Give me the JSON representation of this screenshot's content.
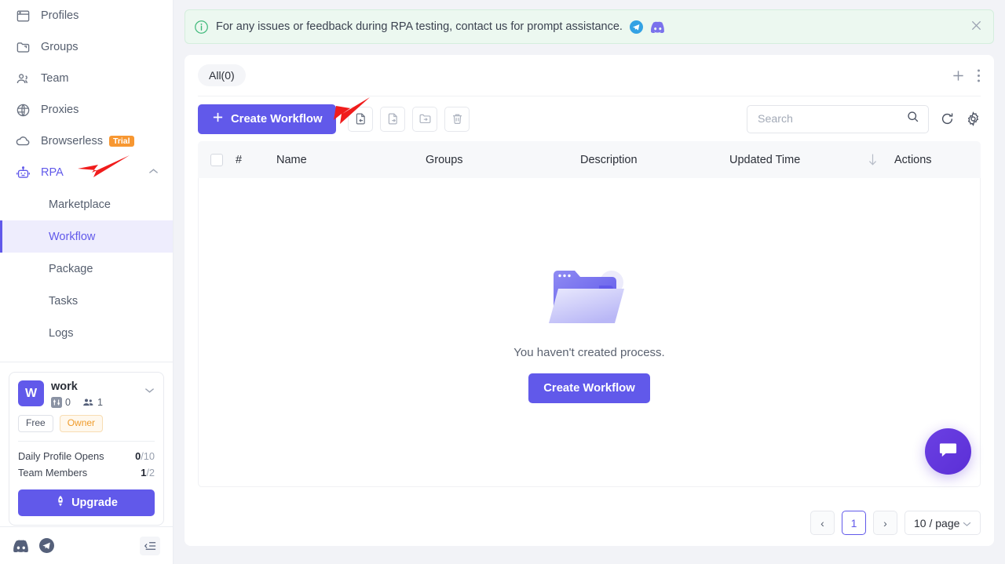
{
  "sidebar": {
    "items": [
      {
        "label": "Profiles",
        "icon": "profiles-icon"
      },
      {
        "label": "Groups",
        "icon": "groups-icon"
      },
      {
        "label": "Team",
        "icon": "team-icon"
      },
      {
        "label": "Proxies",
        "icon": "proxies-icon"
      },
      {
        "label": "Browserless",
        "icon": "cloud-icon",
        "badge": "Trial"
      },
      {
        "label": "RPA",
        "icon": "robot-icon",
        "expanded": true
      }
    ],
    "sub_items": [
      {
        "label": "Marketplace"
      },
      {
        "label": "Workflow",
        "selected": true
      },
      {
        "label": "Package"
      },
      {
        "label": "Tasks"
      },
      {
        "label": "Logs"
      }
    ],
    "workspace": {
      "avatar_letter": "W",
      "name": "work",
      "profiles_count": "0",
      "members_count": "1",
      "plan_tag": "Free",
      "role_tag": "Owner",
      "stats": [
        {
          "label": "Daily Profile Opens",
          "used": "0",
          "total": "/10"
        },
        {
          "label": "Team Members",
          "used": "1",
          "total": "/2"
        }
      ],
      "upgrade_label": "Upgrade"
    }
  },
  "notice": {
    "text": "For any issues or feedback during RPA testing, contact us for prompt assistance.",
    "telegram_icon": "telegram-icon",
    "discord_icon": "discord-icon",
    "close_icon": "close-icon",
    "bg_color": "#ecf8f0"
  },
  "panel": {
    "tab_label": "All(0)",
    "add_icon": "plus-icon",
    "more_icon": "more-vertical-icon",
    "toolbar": {
      "create_label": "Create Workflow",
      "icons": [
        "import-file-icon",
        "export-file-icon",
        "move-to-folder-icon",
        "delete-icon"
      ],
      "search_placeholder": "Search",
      "search_value": "",
      "refresh_icon": "refresh-icon",
      "settings_icon": "gear-icon"
    },
    "table": {
      "columns": [
        "#",
        "Name",
        "Groups",
        "Description",
        "Updated Time",
        "Actions"
      ],
      "sort_icon": "sort-desc-arrow",
      "rows": []
    },
    "empty": {
      "text": "You haven't created process.",
      "button_label": "Create Workflow",
      "illustration": "empty-folder-illustration"
    },
    "pagination": {
      "prev": "‹",
      "pages": [
        "1"
      ],
      "next": "›",
      "page_size": "10 / page"
    }
  },
  "footer": {
    "discord_icon": "discord-icon",
    "telegram_icon": "telegram-icon",
    "collapse_icon": "collapse-sidebar-icon"
  },
  "chat_fab": {
    "icon": "chat-bubble-icon"
  },
  "colors": {
    "accent": "#6159EA",
    "trial_badge": "#F79731",
    "notice_bg": "#ECF8F0"
  }
}
